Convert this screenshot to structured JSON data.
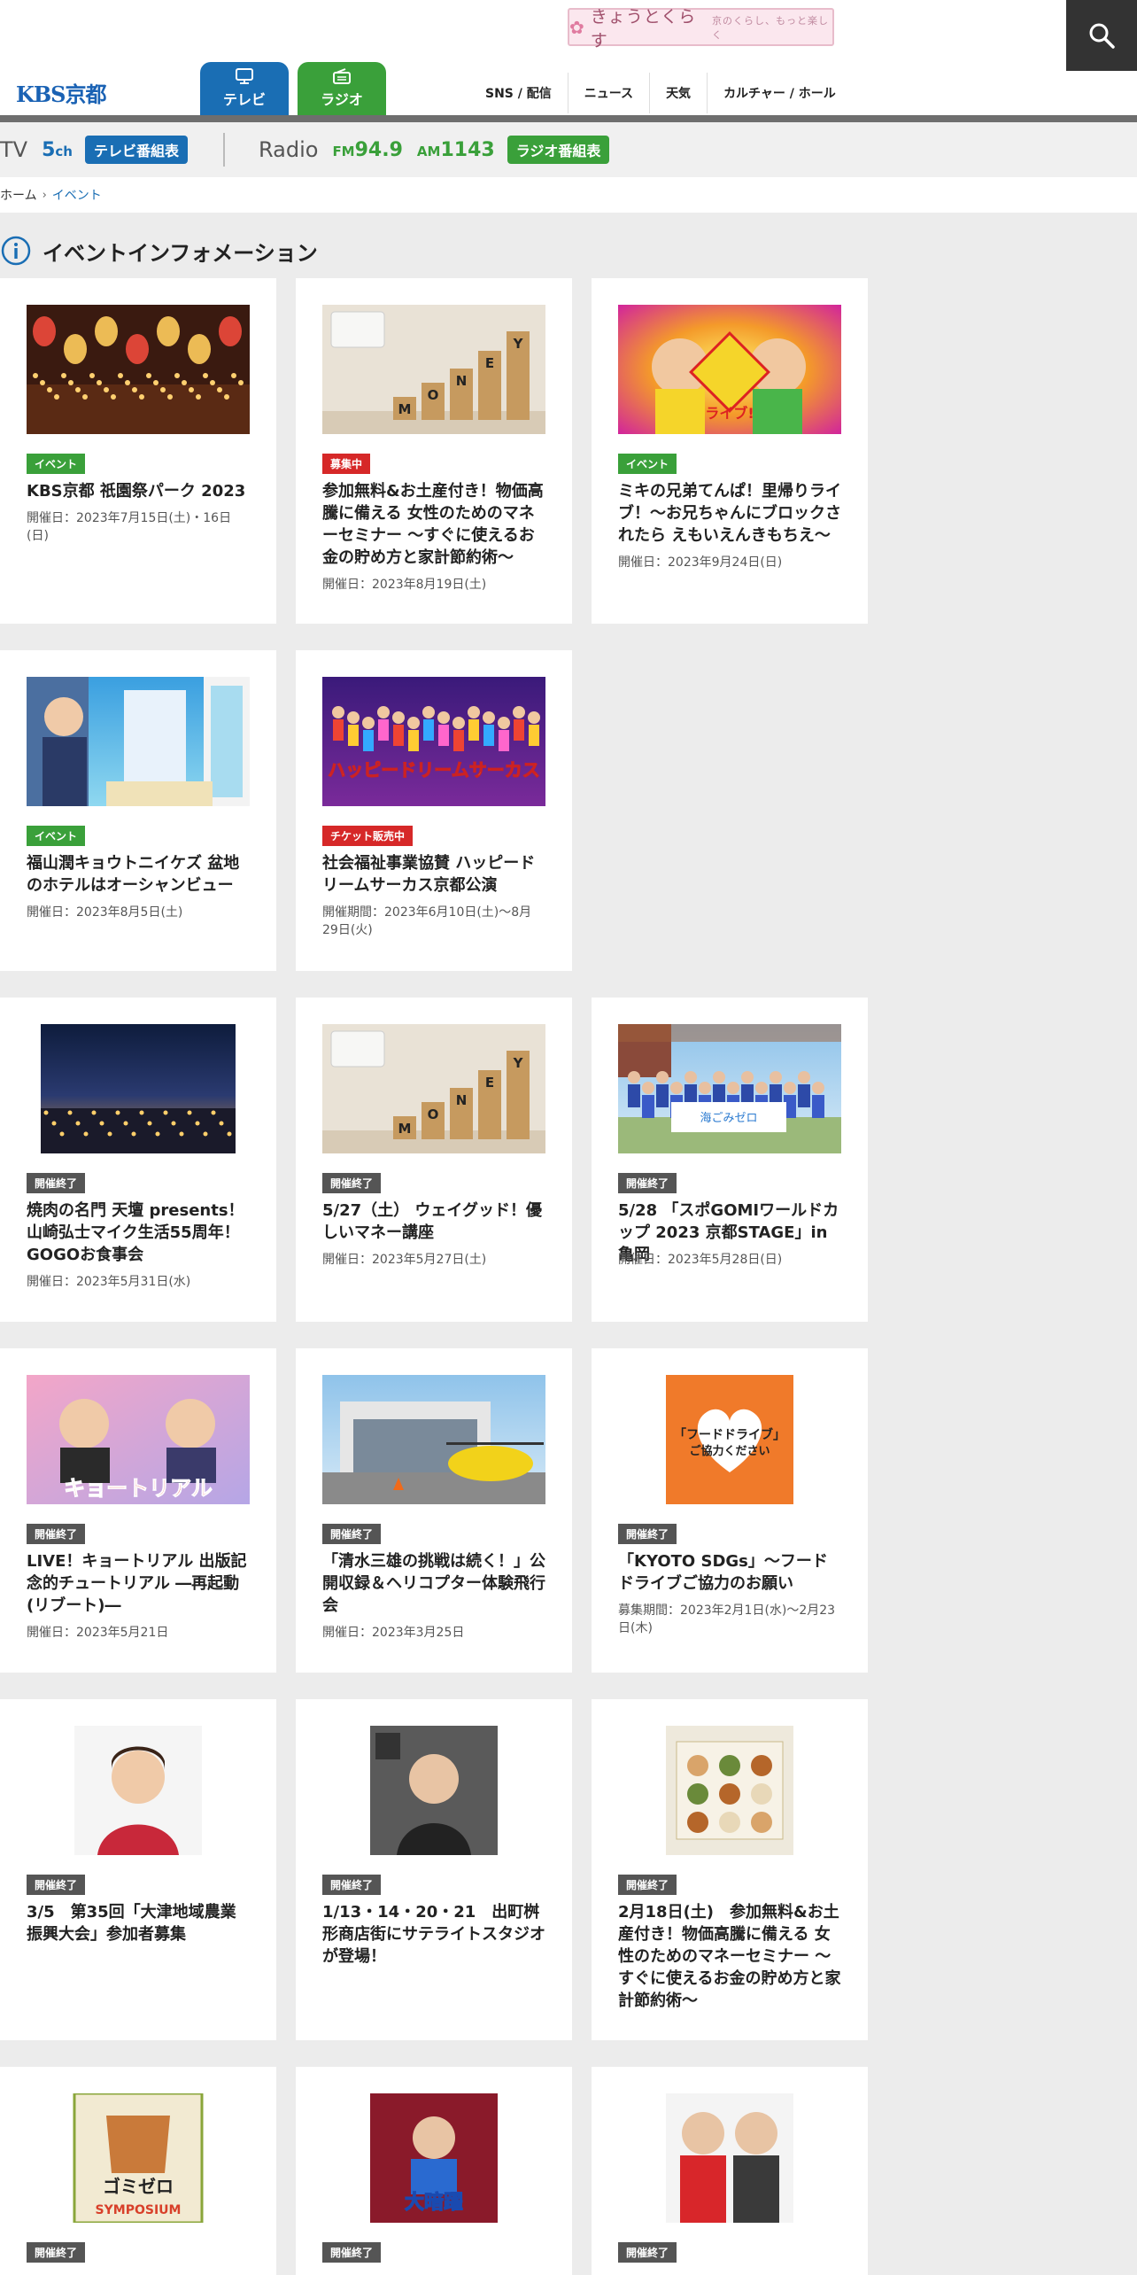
{
  "header": {
    "banner_text": "きょうとくらす",
    "banner_sub": "京のくらし、もっと楽しく",
    "logo": "KBS京都",
    "tabs": [
      {
        "label": "テレビ"
      },
      {
        "label": "ラジオ"
      }
    ],
    "nav": [
      "SNS / 配信",
      "ニュース",
      "天気",
      "カルチャー / ホール"
    ]
  },
  "broadcast": {
    "tv_label": "TV",
    "tv_channel_num": "5",
    "tv_channel_unit": "ch",
    "tv_schedule_btn": "テレビ番組表",
    "radio_label": "Radio",
    "fm_band": "FM",
    "fm_freq": "94.9",
    "am_band": "AM",
    "am_freq": "1143",
    "radio_schedule_btn": "ラジオ番組表"
  },
  "breadcrumb": {
    "home": "ホーム",
    "current": "イベント"
  },
  "section_title": "イベントインフォメーション",
  "colors": {
    "tv_blue": "#1a6eb4",
    "radio_green": "#3aa03a",
    "badge_red": "#d62828",
    "badge_gray": "#555555"
  },
  "cards": [
    {
      "badge": "イベント",
      "title": "KBS京都 祇園祭パーク 2023",
      "date": "開催日：2023年7月15日(土)・16日(日)"
    },
    {
      "badge": "募集中",
      "title": "参加無料&お土産付き！物価高騰に備える 女性のためのマネーセミナー 〜すぐに使えるお金の貯め方と家計節約術〜",
      "date": "開催日：2023年8月19日(土)"
    },
    {
      "badge": "イベント",
      "title": "ミキの兄弟てんぱ！里帰りライブ！〜お兄ちゃんにブロックされたら えもいえんきもちえ〜",
      "date": "開催日：2023年9月24日(日)"
    },
    {
      "badge": "イベント",
      "title": "福山潤キョウトニイケズ 盆地のホテルはオーシャンビュー",
      "date": "開催日：2023年8月5日(土)"
    },
    {
      "badge": "チケット販売中",
      "title": "社会福祉事業協賛 ハッピードリームサーカス京都公演",
      "date": "開催期間：2023年6月10日(土)〜8月29日(火)"
    },
    {
      "badge": "開催終了",
      "title": "焼肉の名門 天壇 presents！山崎弘士マイク生活55周年！GOGOお食事会",
      "date": "開催日：2023年5月31日(水)"
    },
    {
      "badge": "開催終了",
      "title": "5/27（土） ウェイグッド！優しいマネー講座",
      "date": "開催日：2023年5月27日(土)"
    },
    {
      "badge": "開催終了",
      "title": "5/28 「スポGOMIワールドカップ 2023 京都STAGE」in 亀岡",
      "date": "開催日：2023年5月28日(日)"
    },
    {
      "badge": "開催終了",
      "title": "LIVE！キョートリアル 出版記念的チュートリアル ―再起動(リブート)―",
      "date": "開催日：2023年5月21日"
    },
    {
      "badge": "開催終了",
      "title": "「清水三雄の挑戦は続く！」公開収録＆ヘリコプター体験飛行会",
      "date": "開催日：2023年3月25日"
    },
    {
      "badge": "開催終了",
      "title": "「KYOTO SDGs」〜フードドライブご協力のお願い",
      "date": "募集期間：2023年2月1日(水)〜2月23日(木)"
    },
    {
      "badge": "開催終了",
      "title": "3/5　第35回「大津地域農業振興大会」参加者募集",
      "date": ""
    },
    {
      "badge": "開催終了",
      "title": "1/13・14・20・21　出町桝形商店街にサテライトスタジオが登場！",
      "date": ""
    },
    {
      "badge": "開催終了",
      "title": "2月18日(土)　参加無料&お土産付き！物価高騰に備える 女性のためのマネーセミナー 〜すぐに使えるお金の貯め方と家計節約術〜",
      "date": ""
    },
    {
      "badge": "開催終了",
      "title": "",
      "date": ""
    },
    {
      "badge": "開催終了",
      "title": "",
      "date": ""
    },
    {
      "badge": "開催終了",
      "title": "",
      "date": ""
    }
  ],
  "thumb_texts": {
    "money": [
      "M",
      "O",
      "N",
      "E",
      "Y"
    ],
    "food_drive_1": "「フードドライブ」",
    "food_drive_2": "ご協力ください",
    "gomi_zero": "ゴミゼロ",
    "symposium": "SYMPOSIUM",
    "kyotoreal": "キョートリアル",
    "circus": "ハッピードリームサーカス",
    "spogomi": "海ごみゼロ",
    "dai": "大暗躍"
  }
}
